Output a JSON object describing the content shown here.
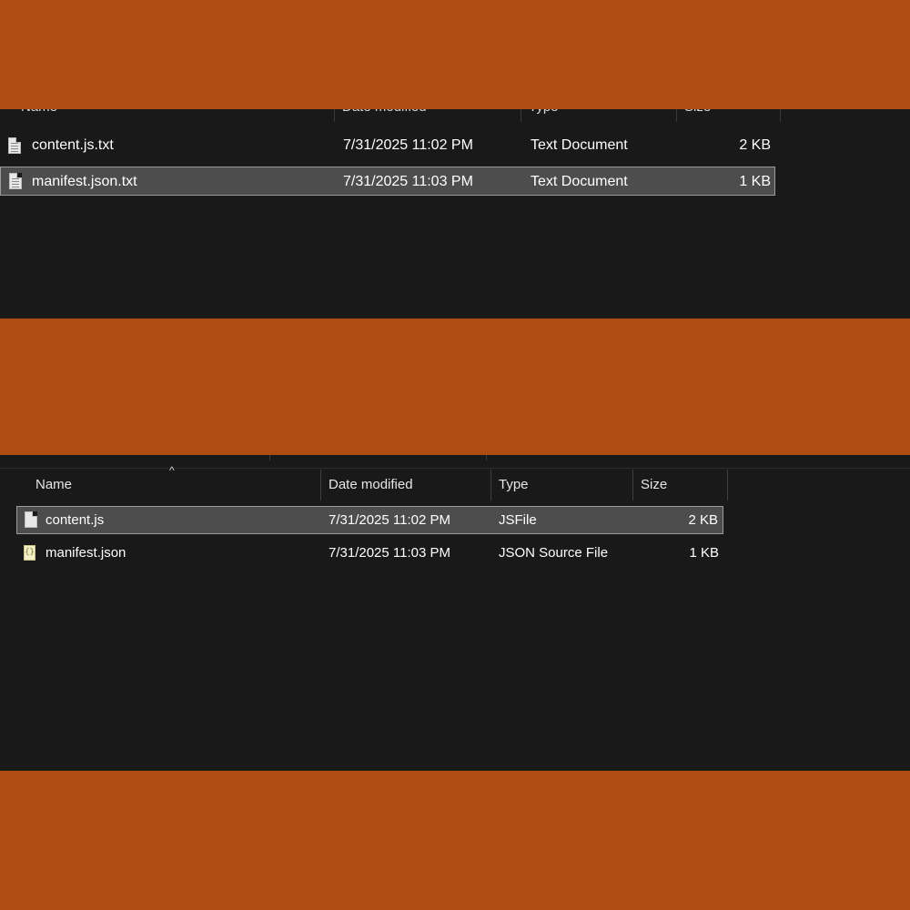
{
  "top_view": {
    "columns": [
      "Name",
      "Date modified",
      "Type",
      "Size"
    ],
    "files": [
      {
        "name": "content.js.txt",
        "date": "7/31/2025 11:02 PM",
        "type": "Text Document",
        "size": "2 KB",
        "icon": "text-file-icon",
        "selected": false
      },
      {
        "name": "manifest.json.txt",
        "date": "7/31/2025 11:03 PM",
        "type": "Text Document",
        "size": "1 KB",
        "icon": "text-file-icon",
        "selected": true
      }
    ]
  },
  "bottom_view": {
    "columns": [
      "Name",
      "Date modified",
      "Type",
      "Size"
    ],
    "sort_indicator": "^",
    "files": [
      {
        "name": "content.js",
        "date": "7/31/2025 11:02 PM",
        "type": "JSFile",
        "size": "2 KB",
        "icon": "js-file-icon",
        "selected": true
      },
      {
        "name": "manifest.json",
        "date": "7/31/2025 11:03 PM",
        "type": "JSON Source File",
        "size": "1 KB",
        "icon": "json-file-icon",
        "selected": false
      }
    ]
  },
  "colors": {
    "band": "#ad4d11",
    "panel": "#191919",
    "selection": "#4d4d4d"
  }
}
